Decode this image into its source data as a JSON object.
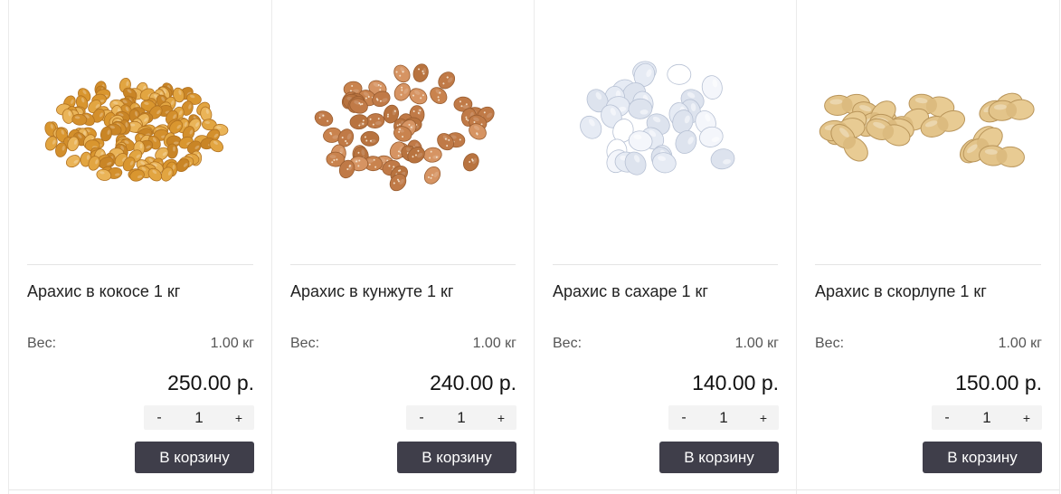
{
  "products": [
    {
      "image_icon": "coconut-peanuts-image",
      "title": "Арахис в кокосе 1 кг",
      "weight_label": "Вес:",
      "weight_value": "1.00 кг",
      "price": "250.00 р.",
      "qty_minus": "-",
      "qty_value": "1",
      "qty_plus": "+",
      "cart_label": "В корзину"
    },
    {
      "image_icon": "sesame-peanuts-image",
      "title": "Арахис в кунжуте 1 кг",
      "weight_label": "Вес:",
      "weight_value": "1.00 кг",
      "price": "240.00 р.",
      "qty_minus": "-",
      "qty_value": "1",
      "qty_plus": "+",
      "cart_label": "В корзину"
    },
    {
      "image_icon": "sugar-peanuts-image",
      "title": "Арахис в сахаре 1 кг",
      "weight_label": "Вес:",
      "weight_value": "1.00 кг",
      "price": "140.00 р.",
      "qty_minus": "-",
      "qty_value": "1",
      "qty_plus": "+",
      "cart_label": "В корзину"
    },
    {
      "image_icon": "in-shell-peanuts-image",
      "title": "Арахис в скорлупе 1 кг",
      "weight_label": "Вес:",
      "weight_value": "1.00 кг",
      "price": "150.00 р.",
      "qty_minus": "-",
      "qty_value": "1",
      "qty_plus": "+",
      "cart_label": "В корзину"
    }
  ],
  "colors": {
    "button_bg": "#3f3e4a",
    "button_text": "#ffffff",
    "border": "#ebebeb"
  }
}
